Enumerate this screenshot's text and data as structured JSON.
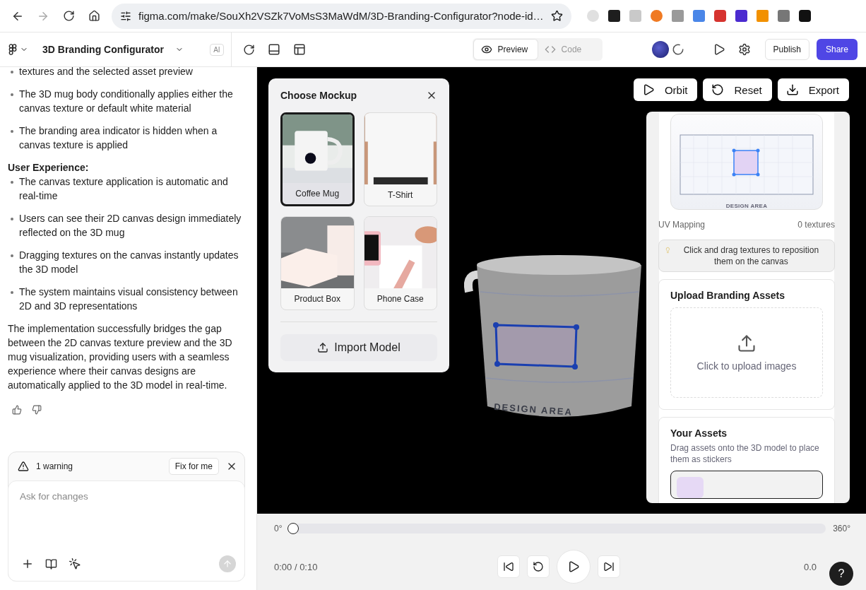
{
  "browser": {
    "url": "figma.com/make/SouXh2VSZk7VoMsS3MaWdM/3D-Branding-Configurator?node-id…"
  },
  "app_bar": {
    "title": "3D Branding Configurator",
    "badge": "AI",
    "view_tabs": [
      {
        "kind": "preview",
        "label": "Preview",
        "selected": true
      },
      {
        "kind": "code",
        "label": "Code",
        "selected": false
      }
    ],
    "publish": "Publish",
    "share": "Share"
  },
  "chat": {
    "messages": [
      {
        "kind": "bullet",
        "text": "textures and the selected asset preview"
      },
      {
        "kind": "bullet",
        "text": "The 3D mug body conditionally applies either the canvas texture or default white material"
      },
      {
        "kind": "bullet",
        "text": "The branding area indicator is hidden when a canvas texture is applied"
      },
      {
        "kind": "heading",
        "text": "User Experience:"
      },
      {
        "kind": "bullet",
        "text": "The canvas texture application is automatic and real-time"
      },
      {
        "kind": "bullet",
        "text": "Users can see their 2D canvas design immediately reflected on the 3D mug"
      },
      {
        "kind": "bullet",
        "text": "Dragging textures on the canvas instantly updates the 3D model"
      },
      {
        "kind": "bullet",
        "text": "The system maintains visual consistency between 2D and 3D representations"
      },
      {
        "kind": "paragraph",
        "text": "The implementation successfully bridges the gap between the 2D canvas texture preview and the 3D mug visualization, providing users with a seamless experience where their canvas designs are automatically applied to the 3D model in real-time."
      }
    ],
    "warning": {
      "text": "1 warning",
      "action": "Fix for me"
    },
    "input": {
      "placeholder": "Ask for changes",
      "send_disabled": true
    }
  },
  "viewer": {
    "mockup_dialog": {
      "title": "Choose Mockup",
      "options": [
        {
          "kind": "mug",
          "label": "Coffee Mug",
          "selected": true
        },
        {
          "kind": "shirt",
          "label": "T-Shirt",
          "selected": false
        },
        {
          "kind": "box",
          "label": "Product Box",
          "selected": false
        },
        {
          "kind": "phone",
          "label": "Phone Case",
          "selected": false
        }
      ],
      "import": "Import Model"
    },
    "actions": [
      {
        "kind": "orbit",
        "label": "Orbit"
      },
      {
        "kind": "reset",
        "label": "Reset"
      },
      {
        "kind": "export",
        "label": "Export"
      }
    ],
    "model": {
      "label": "DESIGN AREA"
    }
  },
  "side_panel": {
    "preview_label": "DESIGN AREA",
    "mapping_label": "UV Mapping",
    "texture_count": "0 textures",
    "hint": "Click and drag textures to reposition them on the canvas",
    "upload": {
      "title": "Upload Branding Assets",
      "prompt": "Click to upload images"
    },
    "assets": {
      "title": "Your Assets",
      "description": "Drag assets onto the 3D model to place them as stickers"
    }
  },
  "timeline": {
    "start": "0°",
    "end": "360°",
    "level": 0,
    "time": "0:00 / 0:10",
    "speed": "0.0"
  },
  "help": "?"
}
